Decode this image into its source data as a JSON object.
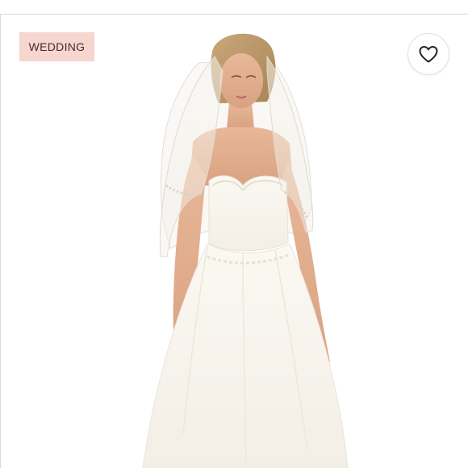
{
  "listing": {
    "category_tag": "WEDDING",
    "like_icon": "heart-outline-icon",
    "photo_subject": "white-strapless-wedding-gown-with-veil"
  },
  "colors": {
    "tag_background": "#f6d6cf",
    "tag_text": "#4a2a2a",
    "heart_stroke": "#222222"
  }
}
